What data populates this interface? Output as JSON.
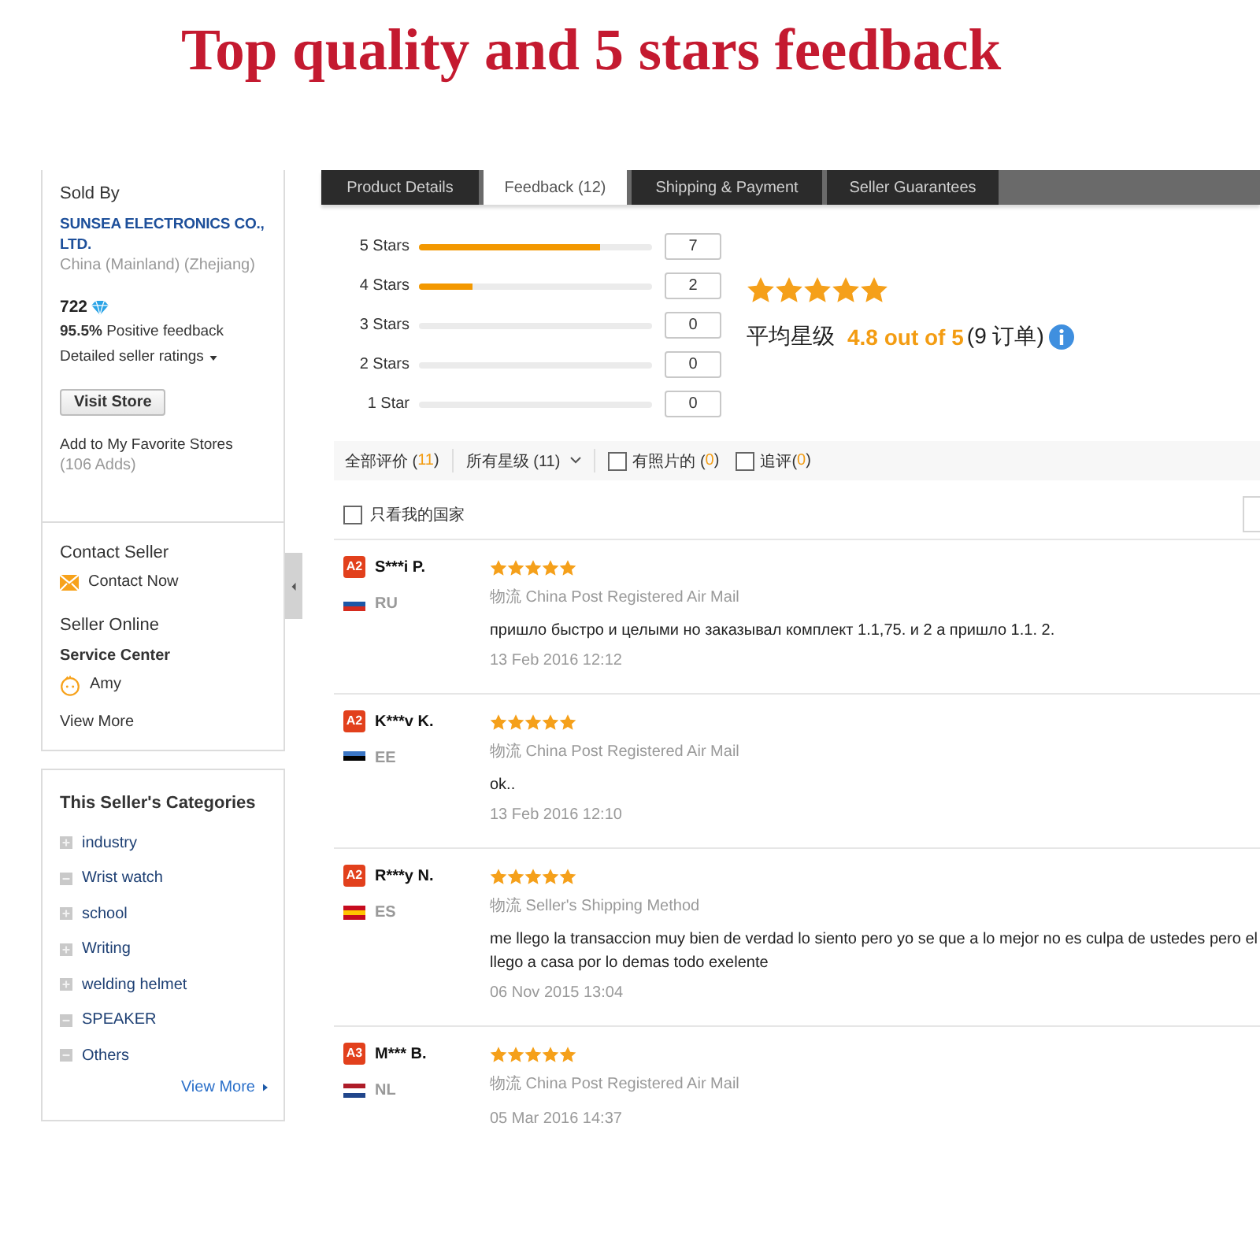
{
  "title": "Top quality and 5 stars feedback",
  "sidebar": {
    "seller": {
      "heading": "Sold By",
      "name": "SUNSEA ELECTRONICS CO., LTD.",
      "location": "China (Mainland) (Zhejiang)",
      "score": "722",
      "positive": "**95.5%** Positive feedback",
      "ratings_link": "Detailed seller ratings",
      "visit_button": "Visit Store",
      "favorite_link": "Add to My Favorite Stores",
      "adds": "(106 Adds)"
    },
    "contact": {
      "heading": "Contact Seller",
      "link": "Contact Now",
      "online_heading": "Seller Online",
      "service": "Service Center",
      "agent": "Amy",
      "view_more": "View More"
    },
    "categories": {
      "heading": "This Seller's Categories",
      "items": [
        {
          "label": "industry",
          "kind": "expandable"
        },
        {
          "label": "Wrist watch",
          "kind": "leaf"
        },
        {
          "label": "school",
          "kind": "expandable"
        },
        {
          "label": "Writing",
          "kind": "expandable"
        },
        {
          "label": "welding helmet",
          "kind": "expandable"
        },
        {
          "label": "SPEAKER",
          "kind": "leaf"
        },
        {
          "label": "Others",
          "kind": "leaf"
        }
      ],
      "view_more": "View More"
    }
  },
  "tabs": [
    {
      "label": "Product Details",
      "selected": false
    },
    {
      "label": "Feedback (12)",
      "selected": true
    },
    {
      "label": "Shipping & Payment",
      "selected": false
    },
    {
      "label": "Seller Guarantees",
      "selected": false
    }
  ],
  "rating_summary": {
    "rows": [
      {
        "label": "5 Stars",
        "level": 0.78,
        "count": "7"
      },
      {
        "label": "4 Stars",
        "level": 0.23,
        "count": "2"
      },
      {
        "label": "3 Stars",
        "level": 0,
        "count": "0"
      },
      {
        "label": "2 Stars",
        "level": 0,
        "count": "0"
      },
      {
        "label": "1 Star",
        "level": 0,
        "count": "0"
      }
    ],
    "stars": 5,
    "average_label": "平均星级",
    "average": "4.8 out of 5",
    "orders": "(9 订单)"
  },
  "filters": [
    {
      "kind": "tab",
      "parts": [
        {
          "text": "全部评价 (",
          "highlight": false
        },
        {
          "text": "11",
          "highlight": true
        },
        {
          "text": ")",
          "highlight": false
        }
      ]
    },
    {
      "kind": "dropdown",
      "parts": [
        {
          "text": "所有星级 (11)",
          "highlight": false
        }
      ]
    },
    {
      "kind": "checkbox",
      "checked": false,
      "parts": [
        {
          "text": "有照片的 (",
          "highlight": false
        },
        {
          "text": "0",
          "highlight": true
        },
        {
          "text": ")",
          "highlight": false
        }
      ]
    },
    {
      "kind": "checkbox",
      "checked": false,
      "parts": [
        {
          "text": "追评(",
          "highlight": false
        },
        {
          "text": "0",
          "highlight": true
        },
        {
          "text": ")",
          "highlight": false
        }
      ]
    }
  ],
  "my_country_filter": {
    "label": "只看我的国家",
    "checked": false
  },
  "reviews": [
    {
      "badge": "A2",
      "name": "S***i P.",
      "flag_stripes": [
        {
          "color": "#ffffff"
        },
        {
          "color": "#1c57a7"
        },
        {
          "color": "#d52b1e"
        }
      ],
      "country": "RU",
      "stars": 5,
      "shipping": "物流 China Post Registered Air Mail",
      "comment_lines": [
        "пришло быстро и целыми но заказывал комплект 1.1,75. и 2 а пришло 1.1. 2."
      ],
      "date": "13 Feb 2016 12:12"
    },
    {
      "badge": "A2",
      "name": "K***v K.",
      "flag_stripes": [
        {
          "color": "#3a75c4"
        },
        {
          "color": "#000000"
        },
        {
          "color": "#ffffff"
        }
      ],
      "country": "EE",
      "stars": 5,
      "shipping": "物流 China Post Registered Air Mail",
      "comment_lines": [
        "ok.."
      ],
      "date": "13 Feb 2016 12:10"
    },
    {
      "badge": "A2",
      "name": "R***y N.",
      "flag_stripes": [
        {
          "color": "#c60b1e"
        },
        {
          "color": "#ffc400"
        },
        {
          "color": "#c60b1e"
        }
      ],
      "country": "ES",
      "stars": 5,
      "shipping": "物流 Seller's Shipping Method",
      "comment_lines": [
        "me llego la transaccion muy bien de verdad lo siento pero yo se que a lo mejor no es culpa de ustedes pero el",
        "llego a casa por lo demas todo exelente"
      ],
      "date": "06 Nov 2015 13:04"
    },
    {
      "badge": "A3",
      "name": "M*** B.",
      "flag_stripes": [
        {
          "color": "#ae1c28"
        },
        {
          "color": "#ffffff"
        },
        {
          "color": "#21468b"
        }
      ],
      "country": "NL",
      "stars": 5,
      "shipping": "物流 China Post Registered Air Mail",
      "date": "05 Mar 2016 14:37"
    }
  ]
}
